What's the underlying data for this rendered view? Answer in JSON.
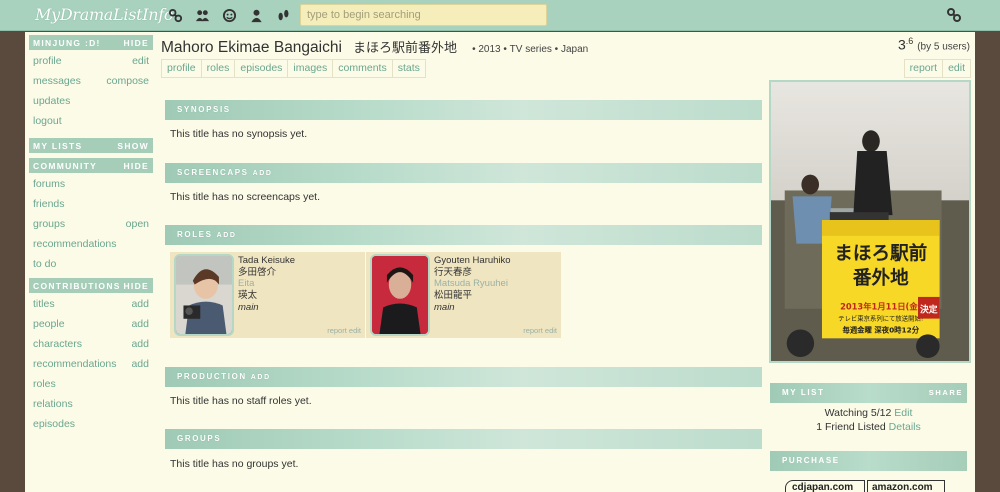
{
  "header": {
    "logo": "MyDramaListInfo",
    "search_placeholder": "type to begin searching",
    "icons": [
      "link-icon",
      "people-icon",
      "smile-icon",
      "user-icon",
      "footprints-icon"
    ]
  },
  "sidebar": {
    "user": {
      "title": "MINJUNG :D!",
      "action": "HIDE"
    },
    "user_items": [
      {
        "label": "profile",
        "action": "edit"
      },
      {
        "label": "messages",
        "action": "compose"
      },
      {
        "label": "updates",
        "action": ""
      },
      {
        "label": "logout",
        "action": ""
      }
    ],
    "lists": {
      "title": "MY LISTS",
      "action": "SHOW"
    },
    "community": {
      "title": "COMMUNITY",
      "action": "HIDE"
    },
    "community_items": [
      {
        "label": "forums",
        "action": ""
      },
      {
        "label": "friends",
        "action": ""
      },
      {
        "label": "groups",
        "action": "open"
      },
      {
        "label": "recommendations",
        "action": ""
      },
      {
        "label": "to do",
        "action": ""
      }
    ],
    "contributions": {
      "title": "CONTRIBUTIONS",
      "action": "HIDE"
    },
    "contribution_items": [
      {
        "label": "titles",
        "action": "add"
      },
      {
        "label": "people",
        "action": "add"
      },
      {
        "label": "characters",
        "action": "add"
      },
      {
        "label": "recommendations",
        "action": "add"
      },
      {
        "label": "roles",
        "action": ""
      },
      {
        "label": "relations",
        "action": ""
      },
      {
        "label": "episodes",
        "action": ""
      }
    ]
  },
  "title": {
    "english": "Mahoro Ekimae Bangaichi",
    "japanese": "まほろ駅前番外地",
    "meta": "• 2013  • TV series  • Japan",
    "rating_int": "3",
    "rating_dec": ".6",
    "rating_users": "(by 5 users)"
  },
  "tabs": [
    "profile",
    "roles",
    "episodes",
    "images",
    "comments",
    "stats"
  ],
  "right_tabs": [
    "report",
    "edit"
  ],
  "sections": {
    "synopsis": {
      "title": "SYNOPSIS",
      "text": "This title has no synopsis yet."
    },
    "screencaps": {
      "title": "SCREENCAPS",
      "add": "ADD",
      "text": "This title has no screencaps yet."
    },
    "roles": {
      "title": "ROLES",
      "add": "ADD"
    },
    "production": {
      "title": "PRODUCTION",
      "add": "ADD",
      "text": "This title has no staff roles yet."
    },
    "groups": {
      "title": "GROUPS",
      "text": "This title has no groups yet."
    }
  },
  "roles": [
    {
      "name": "Tada Keisuke",
      "name_jp": "多田啓介",
      "actor": "Eita",
      "actor_jp": "瑛太",
      "type": "main",
      "report": "report",
      "edit": "edit"
    },
    {
      "name": "Gyouten Haruhiko",
      "name_jp": "行天春彦",
      "actor": "Matsuda Ryuuhei",
      "actor_jp": "松田龍平",
      "type": "main",
      "report": "report",
      "edit": "edit"
    }
  ],
  "poster": {
    "title_line1": "まほろ駅前",
    "title_line2": "番外地",
    "date": "2013年1月11日(金)",
    "sub": "テレビ東京系列にて放送開始!",
    "time": "毎週金曜 深夜0時12分",
    "badge": "決定"
  },
  "mylist": {
    "title": "MY LIST",
    "action": "SHARE",
    "watching": "Watching 5/12",
    "edit": "Edit",
    "friends": "1 Friend Listed",
    "details": "Details"
  },
  "purchase": {
    "title": "PURCHASE",
    "stores": [
      "cdjapan.com",
      "amazon.com"
    ]
  },
  "colors": {
    "accent": "#a8d1be",
    "link": "#6aa790",
    "page_bg": "#fcfbe7",
    "card_bg": "#efe5c1"
  }
}
